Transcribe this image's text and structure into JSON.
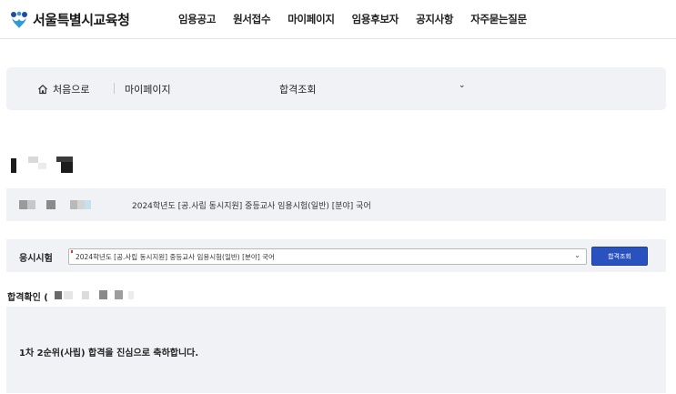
{
  "header": {
    "logo_text": "서울특별시교육청",
    "nav": [
      "임용공고",
      "원서접수",
      "마이페이지",
      "임용후보자",
      "공지사항",
      "자주묻는질문"
    ]
  },
  "breadcrumb": {
    "home": "처음으로",
    "level1": "마이페이지",
    "level2": "합격조회"
  },
  "exam_info": {
    "title": "2024학년도 [공.사립 동시지원] 중등교사 임용시험(일반) [분야] 국어"
  },
  "exam_select": {
    "label": "응시시험",
    "selected": "2024학년도 [공.사립 동시지원] 중등교사 임용시험(일반) [분야] 국어",
    "button": "합격조회"
  },
  "result": {
    "title_prefix": "합격확인 (",
    "message": "1차 2순위(사립) 합격을 진심으로 축하합니다."
  },
  "colors": {
    "accent": "#2a52be",
    "panel": "#f1f2f5"
  }
}
